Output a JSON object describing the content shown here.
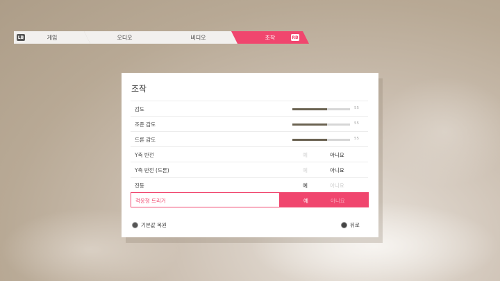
{
  "tabs": {
    "left_button": "LB",
    "right_button": "RB",
    "items": [
      {
        "label": "게임"
      },
      {
        "label": "오디오"
      },
      {
        "label": "비디오"
      },
      {
        "label": "조작",
        "active": true
      }
    ]
  },
  "panel": {
    "title": "조작",
    "sliders": [
      {
        "label": "감도",
        "value": 55,
        "fraction": 0.6
      },
      {
        "label": "조준 감도",
        "value": 55,
        "fraction": 0.6
      },
      {
        "label": "드론 감도",
        "value": 55,
        "fraction": 0.6
      }
    ],
    "toggles": [
      {
        "label": "Y축 반전",
        "yes": "예",
        "no": "아니요",
        "selected": "no"
      },
      {
        "label": "Y축 반전 (드론)",
        "yes": "예",
        "no": "아니요",
        "selected": "no"
      },
      {
        "label": "진동",
        "yes": "예",
        "no": "아니요",
        "selected": "yes"
      },
      {
        "label": "적응형 트리거",
        "yes": "예",
        "no": "아니요",
        "selected": "yes",
        "focused": true
      }
    ],
    "footer": {
      "reset": "기본값 복원",
      "back": "뒤로"
    }
  },
  "colors": {
    "accent": "#f0466e",
    "slider_fill": "#6a6251"
  }
}
